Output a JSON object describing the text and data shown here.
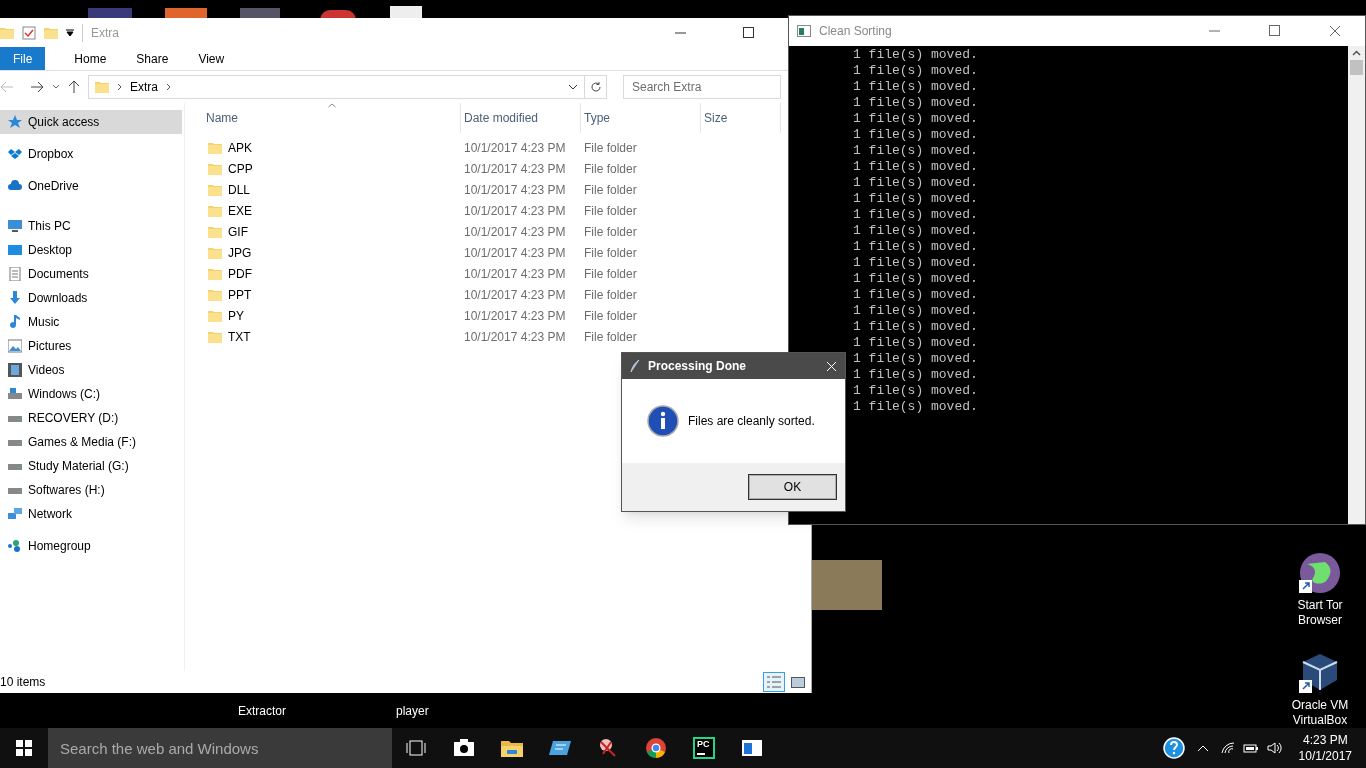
{
  "explorer": {
    "title": "Extra",
    "ribbon_tabs": [
      {
        "label": "File",
        "selected": true
      },
      {
        "label": "Home",
        "selected": false
      },
      {
        "label": "Share",
        "selected": false
      },
      {
        "label": "View",
        "selected": false
      }
    ],
    "breadcrumb": "Extra",
    "search": {
      "placeholder": "Search Extra"
    },
    "sidebar": [
      {
        "label": "Quick access",
        "kind": "star",
        "selected": true
      },
      {
        "label": "Dropbox",
        "kind": "dropbox",
        "selected": false
      },
      {
        "label": "OneDrive",
        "kind": "cloud",
        "selected": false
      },
      {
        "label": "This PC",
        "kind": "pc",
        "selected": false,
        "children": [
          {
            "label": "Desktop",
            "kind": "desktop",
            "selected": false
          },
          {
            "label": "Documents",
            "kind": "documents",
            "selected": false
          },
          {
            "label": "Downloads",
            "kind": "downloads",
            "selected": false
          },
          {
            "label": "Music",
            "kind": "music",
            "selected": false
          },
          {
            "label": "Pictures",
            "kind": "pictures",
            "selected": false
          },
          {
            "label": "Videos",
            "kind": "videos",
            "selected": false
          },
          {
            "label": "Windows (C:)",
            "kind": "windows-drive",
            "selected": false
          },
          {
            "label": "RECOVERY (D:)",
            "kind": "drive",
            "selected": false
          },
          {
            "label": "Games & Media (F:)",
            "kind": "drive",
            "selected": false
          },
          {
            "label": "Study Material (G:)",
            "kind": "drive",
            "selected": false
          },
          {
            "label": "Softwares (H:)",
            "kind": "drive",
            "selected": false
          }
        ]
      },
      {
        "label": "Network",
        "kind": "network",
        "selected": false
      },
      {
        "label": "Homegroup",
        "kind": "homegroup",
        "selected": false
      }
    ],
    "columns": [
      {
        "label": "Name",
        "sorted": true
      },
      {
        "label": "Date modified",
        "sorted": false
      },
      {
        "label": "Type",
        "sorted": false
      },
      {
        "label": "Size",
        "sorted": false
      }
    ],
    "rows": [
      {
        "name": "APK",
        "date": "10/1/2017 4:23 PM",
        "type": "File folder"
      },
      {
        "name": "CPP",
        "date": "10/1/2017 4:23 PM",
        "type": "File folder"
      },
      {
        "name": "DLL",
        "date": "10/1/2017 4:23 PM",
        "type": "File folder"
      },
      {
        "name": "EXE",
        "date": "10/1/2017 4:23 PM",
        "type": "File folder"
      },
      {
        "name": "GIF",
        "date": "10/1/2017 4:23 PM",
        "type": "File folder"
      },
      {
        "name": "JPG",
        "date": "10/1/2017 4:23 PM",
        "type": "File folder"
      },
      {
        "name": "PDF",
        "date": "10/1/2017 4:23 PM",
        "type": "File folder"
      },
      {
        "name": "PPT",
        "date": "10/1/2017 4:23 PM",
        "type": "File folder"
      },
      {
        "name": "PY",
        "date": "10/1/2017 4:23 PM",
        "type": "File folder"
      },
      {
        "name": "TXT",
        "date": "10/1/2017 4:23 PM",
        "type": "File folder"
      }
    ],
    "status": "10 items",
    "views": [
      {
        "kind": "details",
        "selected": true
      },
      {
        "kind": "large-icons",
        "selected": false
      }
    ]
  },
  "console": {
    "title": "Clean Sorting",
    "lines": [
      "1 file(s) moved.",
      "1 file(s) moved.",
      "1 file(s) moved.",
      "1 file(s) moved.",
      "1 file(s) moved.",
      "1 file(s) moved.",
      "1 file(s) moved.",
      "1 file(s) moved.",
      "1 file(s) moved.",
      "1 file(s) moved.",
      "1 file(s) moved.",
      "1 file(s) moved.",
      "1 file(s) moved.",
      "1 file(s) moved.",
      "1 file(s) moved.",
      "1 file(s) moved.",
      "1 file(s) moved.",
      "1 file(s) moved.",
      "1 file(s) moved.",
      "1 file(s) moved.",
      "1 file(s) moved.",
      "1 file(s) moved.",
      "1 file(s) moved."
    ]
  },
  "dialog": {
    "title": "Processing Done",
    "message": "Files are cleanly sorted.",
    "button": "OK"
  },
  "desktop": {
    "icons": [
      {
        "label": "Start Tor\nBrowser",
        "kind": "globe"
      },
      {
        "label": "Oracle VM\nVirtualBox",
        "kind": "box"
      }
    ],
    "cut_labels": [
      "Extractor",
      "player"
    ]
  },
  "taskbar": {
    "search": {
      "placeholder": "Search the web and Windows"
    },
    "apps": [
      {
        "kind": "task-view"
      },
      {
        "kind": "camera"
      },
      {
        "kind": "folder"
      },
      {
        "kind": "card"
      },
      {
        "kind": "snip"
      },
      {
        "kind": "chrome"
      },
      {
        "kind": "pycharm",
        "text": "PC"
      },
      {
        "kind": "window"
      }
    ],
    "time": "4:23 PM",
    "date": "10/1/2017"
  }
}
